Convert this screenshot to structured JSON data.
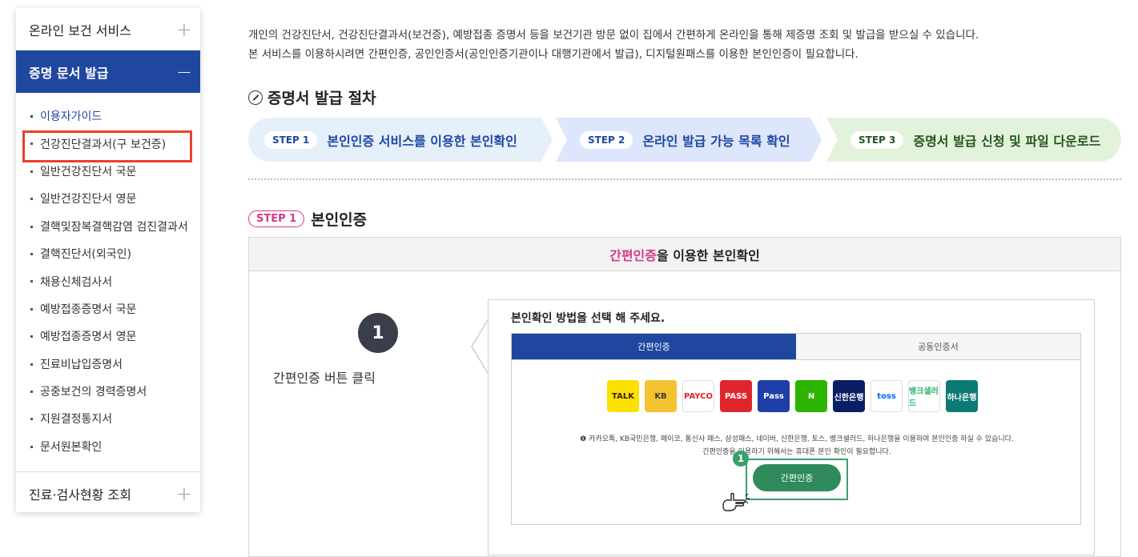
{
  "sidebar": {
    "online_health_service": "온라인 보건 서비스",
    "cert_issue": "증명 문서 발급",
    "items": [
      {
        "label": "이용자가이드"
      },
      {
        "label": "건강진단결과서(구 보건증)"
      },
      {
        "label": "일반건강진단서 국문"
      },
      {
        "label": "일반건강진단서 영문"
      },
      {
        "label": "결핵및잠복결핵감염 검진결과서"
      },
      {
        "label": "결핵진단서(외국인)"
      },
      {
        "label": "채용신체검사서"
      },
      {
        "label": "예방접종증명서 국문"
      },
      {
        "label": "예방접종증명서 영문"
      },
      {
        "label": "진료비납입증명서"
      },
      {
        "label": "공중보건의 경력증명서"
      },
      {
        "label": "지원결정통지서"
      },
      {
        "label": "문서원본확인"
      }
    ],
    "medical_status": "진료·검사현황 조회",
    "plus": "+",
    "minus": "−"
  },
  "intro": {
    "line1": "개인의 건강진단서, 건강진단결과서(보건증), 예방접종 증명서 등을 보건기관 방문 없이 집에서 간편하게 온라인을 통해 제증명 조회 및 발급을 받으실 수 있습니다.",
    "line2": "본 서비스를 이용하시려면 간편인증, 공인인증서(공인인증기관이나 대행기관에서 발급), 디지털원패스를 이용한 본인인증이 필요합니다."
  },
  "procedure_title": "증명서 발급 절차",
  "steps": [
    {
      "badge": "STEP 1",
      "label": "본인인증 서비스를 이용한 본인확인"
    },
    {
      "badge": "STEP 2",
      "label": "온라인 발급 가능 목록 확인"
    },
    {
      "badge": "STEP 3",
      "label": "증명서 발급 신청 및 파일 다운로드"
    }
  ],
  "step1_section": {
    "badge": "STEP 1",
    "title": "본인인증",
    "panel_head_pink": "간편인증",
    "panel_head_rest": "을 이용한 본인확인",
    "number": "1",
    "instruction": "간편인증 버튼 클릭"
  },
  "mock": {
    "title": "본인확인 방법을 선택 해 주세요.",
    "tab_simple": "간편인증",
    "tab_cert": "공동인증서",
    "providers": [
      {
        "name": "TALK",
        "color": "#fae100",
        "text_color": "#3a1d1d"
      },
      {
        "name": "KB",
        "color": "#f2c230",
        "text_color": "#3a3a3a"
      },
      {
        "name": "PAYCO",
        "color": "#ffffff",
        "text_color": "#e0262d"
      },
      {
        "name": "PASS",
        "color": "#e0262d",
        "text_color": "#ffffff"
      },
      {
        "name": "Pass",
        "color": "#1f3fa8",
        "text_color": "#ffffff"
      },
      {
        "name": "N",
        "color": "#2db400",
        "text_color": "#ffffff"
      },
      {
        "name": "신한은행",
        "color": "#0a1f63",
        "text_color": "#ffffff"
      },
      {
        "name": "toss",
        "color": "#ffffff",
        "text_color": "#0064ff"
      },
      {
        "name": "뱅크샐러드",
        "color": "#ffffff",
        "text_color": "#29b36b"
      },
      {
        "name": "하나은행",
        "color": "#0b7a73",
        "text_color": "#ffffff"
      }
    ],
    "note1": "❶ 카카오톡, KB국민은행, 페이코, 통신사 패스, 삼성패스, 네이버, 신한은행, 토스, 뱅크샐러드, 하나은행을 이용하여 본인인증 하실 수 있습니다.",
    "note2": "간편인증을 이용하기 위해서는 휴대폰 본인 확인이 필요합니다.",
    "auth_button": "간편인증",
    "auth_num": "1"
  }
}
